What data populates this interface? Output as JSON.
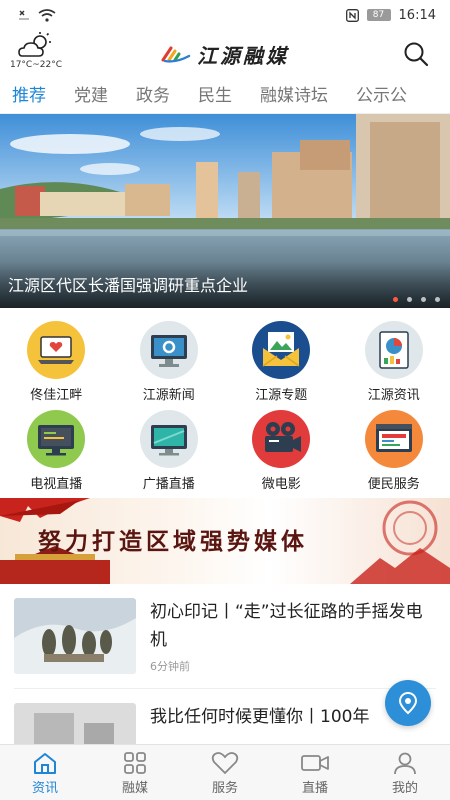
{
  "status_bar": {
    "battery": "87",
    "time": "16:14"
  },
  "header": {
    "weather_temp": "17°C~22°C",
    "logo_text": "江源融媒"
  },
  "tabs": [
    {
      "label": "推荐",
      "active": true
    },
    {
      "label": "党建"
    },
    {
      "label": "政务"
    },
    {
      "label": "民生"
    },
    {
      "label": "融媒诗坛"
    },
    {
      "label": "公示公"
    }
  ],
  "banner": {
    "title": "江源区代区长潘国强调研重点企业",
    "dot_count": 4,
    "active_dot": 0
  },
  "grid": [
    {
      "label": "佟佳江畔",
      "icon": "laptop-heart-icon"
    },
    {
      "label": "江源新闻",
      "icon": "monitor-gear-icon"
    },
    {
      "label": "江源专题",
      "icon": "picture-envelope-icon"
    },
    {
      "label": "江源资讯",
      "icon": "report-chart-icon"
    },
    {
      "label": "电视直播",
      "icon": "tv-icon"
    },
    {
      "label": "广播直播",
      "icon": "radio-screen-icon"
    },
    {
      "label": "微电影",
      "icon": "film-camera-icon"
    },
    {
      "label": "便民服务",
      "icon": "service-window-icon"
    }
  ],
  "slogan": {
    "text": "努力打造区域强势媒体"
  },
  "news": [
    {
      "title": "初心印记丨“走”过长征路的手摇发电机",
      "time": "6分钟前"
    },
    {
      "title": "我比任何时候更懂你丨100年",
      "time": ""
    }
  ],
  "bottom_nav": [
    {
      "label": "资讯",
      "icon": "home-icon",
      "active": true
    },
    {
      "label": "融媒",
      "icon": "grid-icon"
    },
    {
      "label": "服务",
      "icon": "heart-icon"
    },
    {
      "label": "直播",
      "icon": "video-camera-icon"
    },
    {
      "label": "我的",
      "icon": "user-icon"
    }
  ],
  "colors": {
    "accent": "#1f86d6",
    "dot_active": "#ff5a3c"
  }
}
